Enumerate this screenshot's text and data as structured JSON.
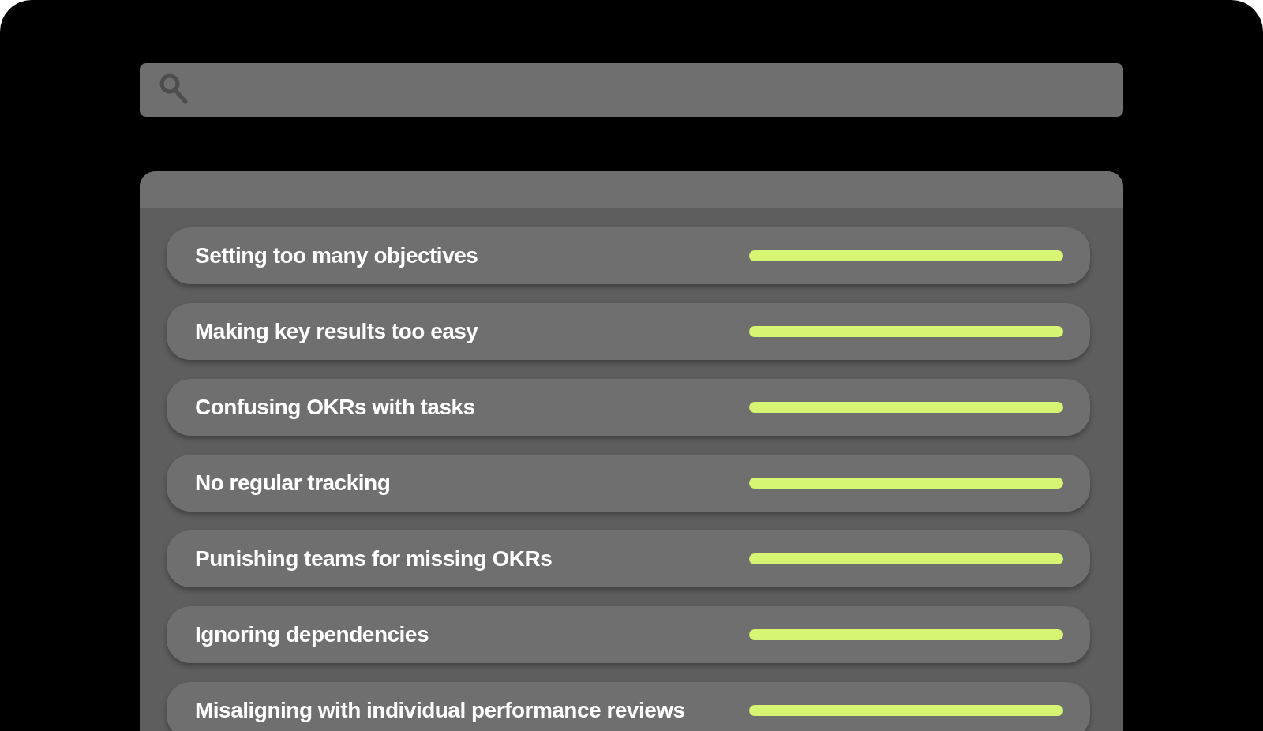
{
  "search": {
    "kind": "search"
  },
  "items": [
    {
      "label": "Setting too many objectives",
      "level": 1
    },
    {
      "label": "Making key results too easy",
      "level": 1
    },
    {
      "label": "Confusing OKRs with tasks",
      "level": 1
    },
    {
      "label": "No regular tracking",
      "level": 1
    },
    {
      "label": "Punishing teams for missing OKRs",
      "level": 1
    },
    {
      "label": "Ignoring dependencies",
      "level": 1
    },
    {
      "label": "Misaligning with individual performance reviews",
      "level": 1
    }
  ]
}
